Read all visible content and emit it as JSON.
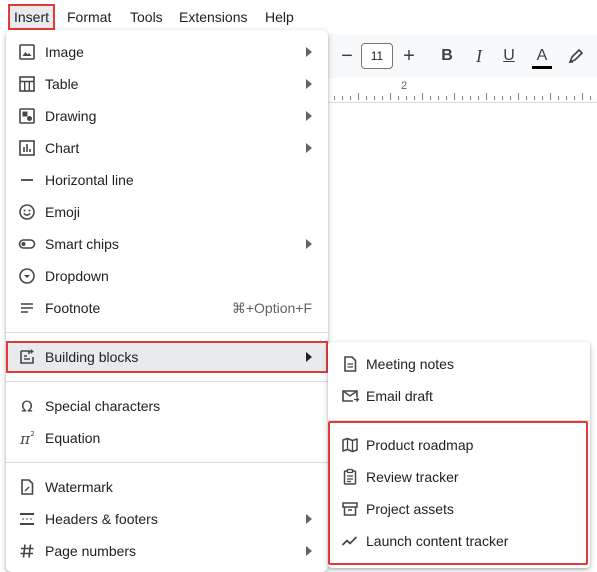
{
  "menubar": {
    "items": [
      "Insert",
      "Format",
      "Tools",
      "Extensions",
      "Help"
    ]
  },
  "toolbar": {
    "font_size": "11",
    "minus": "−",
    "plus": "+",
    "bold": "B",
    "italic": "I",
    "underline": "U",
    "text_color": "A"
  },
  "ruler": {
    "mark": "2"
  },
  "insert_menu": {
    "items": [
      {
        "label": "Image",
        "icon": "image-icon",
        "submenu": true
      },
      {
        "label": "Table",
        "icon": "table-icon",
        "submenu": true
      },
      {
        "label": "Drawing",
        "icon": "drawing-icon",
        "submenu": true
      },
      {
        "label": "Chart",
        "icon": "chart-icon",
        "submenu": true
      },
      {
        "label": "Horizontal line",
        "icon": "horizontal-line-icon",
        "submenu": false
      },
      {
        "label": "Emoji",
        "icon": "emoji-icon",
        "submenu": false
      },
      {
        "label": "Smart chips",
        "icon": "smart-chips-icon",
        "submenu": true
      },
      {
        "label": "Dropdown",
        "icon": "dropdown-icon",
        "submenu": false
      },
      {
        "label": "Footnote",
        "icon": "footnote-icon",
        "submenu": false,
        "shortcut": "⌘+Option+F"
      },
      {
        "label": "Building blocks",
        "icon": "building-blocks-icon",
        "submenu": true,
        "highlighted": true
      },
      {
        "label": "Special characters",
        "icon": "omega-icon",
        "submenu": false
      },
      {
        "label": "Equation",
        "icon": "pi-icon",
        "submenu": false
      },
      {
        "label": "Watermark",
        "icon": "watermark-icon",
        "submenu": false
      },
      {
        "label": "Headers & footers",
        "icon": "headers-footers-icon",
        "submenu": true
      },
      {
        "label": "Page numbers",
        "icon": "hash-icon",
        "submenu": true
      }
    ]
  },
  "building_blocks_submenu": {
    "items": [
      {
        "label": "Meeting notes",
        "icon": "document-icon"
      },
      {
        "label": "Email draft",
        "icon": "email-icon"
      },
      {
        "label": "Product roadmap",
        "icon": "map-icon"
      },
      {
        "label": "Review tracker",
        "icon": "clipboard-icon"
      },
      {
        "label": "Project assets",
        "icon": "archive-icon"
      },
      {
        "label": "Launch content tracker",
        "icon": "trending-icon"
      }
    ]
  },
  "colors": {
    "highlight_outline": "#e53935",
    "menu_hover": "#e8eaed",
    "icon": "#444746"
  }
}
